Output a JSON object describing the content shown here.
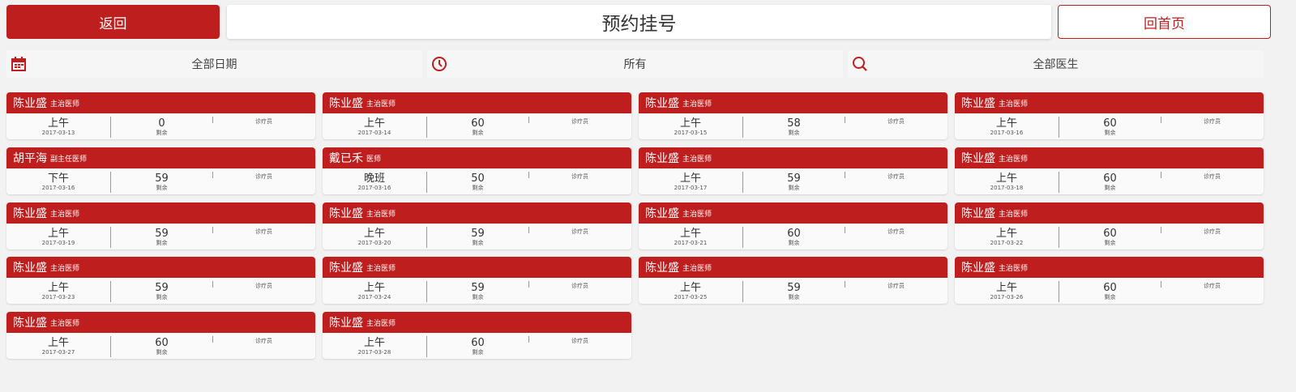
{
  "header": {
    "back_label": "返回",
    "title": "预约挂号",
    "home_label": "回首页"
  },
  "filters": {
    "date_label": "全部日期",
    "time_label": "所有",
    "doctor_label": "全部医生"
  },
  "colors": {
    "accent": "#bf1e1e",
    "background": "#f2f2f2"
  },
  "slots": [
    {
      "doctor": "陈业盛",
      "title": "主治医师",
      "period": "上午",
      "date": "2017-03-13",
      "count": "0",
      "remain_label": "剩余",
      "room": "诊疗员"
    },
    {
      "doctor": "陈业盛",
      "title": "主治医师",
      "period": "上午",
      "date": "2017-03-14",
      "count": "60",
      "remain_label": "剩余",
      "room": "诊疗员"
    },
    {
      "doctor": "陈业盛",
      "title": "主治医师",
      "period": "上午",
      "date": "2017-03-15",
      "count": "58",
      "remain_label": "剩余",
      "room": "诊疗员"
    },
    {
      "doctor": "陈业盛",
      "title": "主治医师",
      "period": "上午",
      "date": "2017-03-16",
      "count": "60",
      "remain_label": "剩余",
      "room": "诊疗员"
    },
    {
      "doctor": "胡平海",
      "title": "副主任医师",
      "period": "下午",
      "date": "2017-03-16",
      "count": "59",
      "remain_label": "剩余",
      "room": "诊疗员"
    },
    {
      "doctor": "戴已禾",
      "title": "医师",
      "period": "晚班",
      "date": "2017-03-16",
      "count": "50",
      "remain_label": "剩余",
      "room": "诊疗员"
    },
    {
      "doctor": "陈业盛",
      "title": "主治医师",
      "period": "上午",
      "date": "2017-03-17",
      "count": "59",
      "remain_label": "剩余",
      "room": "诊疗员"
    },
    {
      "doctor": "陈业盛",
      "title": "主治医师",
      "period": "上午",
      "date": "2017-03-18",
      "count": "60",
      "remain_label": "剩余",
      "room": "诊疗员"
    },
    {
      "doctor": "陈业盛",
      "title": "主治医师",
      "period": "上午",
      "date": "2017-03-19",
      "count": "59",
      "remain_label": "剩余",
      "room": "诊疗员"
    },
    {
      "doctor": "陈业盛",
      "title": "主治医师",
      "period": "上午",
      "date": "2017-03-20",
      "count": "59",
      "remain_label": "剩余",
      "room": "诊疗员"
    },
    {
      "doctor": "陈业盛",
      "title": "主治医师",
      "period": "上午",
      "date": "2017-03-21",
      "count": "60",
      "remain_label": "剩余",
      "room": "诊疗员"
    },
    {
      "doctor": "陈业盛",
      "title": "主治医师",
      "period": "上午",
      "date": "2017-03-22",
      "count": "60",
      "remain_label": "剩余",
      "room": "诊疗员"
    },
    {
      "doctor": "陈业盛",
      "title": "主治医师",
      "period": "上午",
      "date": "2017-03-23",
      "count": "59",
      "remain_label": "剩余",
      "room": "诊疗员"
    },
    {
      "doctor": "陈业盛",
      "title": "主治医师",
      "period": "上午",
      "date": "2017-03-24",
      "count": "59",
      "remain_label": "剩余",
      "room": "诊疗员"
    },
    {
      "doctor": "陈业盛",
      "title": "主治医师",
      "period": "上午",
      "date": "2017-03-25",
      "count": "59",
      "remain_label": "剩余",
      "room": "诊疗员"
    },
    {
      "doctor": "陈业盛",
      "title": "主治医师",
      "period": "上午",
      "date": "2017-03-26",
      "count": "60",
      "remain_label": "剩余",
      "room": "诊疗员"
    },
    {
      "doctor": "陈业盛",
      "title": "主治医师",
      "period": "上午",
      "date": "2017-03-27",
      "count": "60",
      "remain_label": "剩余",
      "room": "诊疗员"
    },
    {
      "doctor": "陈业盛",
      "title": "主治医师",
      "period": "上午",
      "date": "2017-03-28",
      "count": "60",
      "remain_label": "剩余",
      "room": "诊疗员"
    }
  ]
}
